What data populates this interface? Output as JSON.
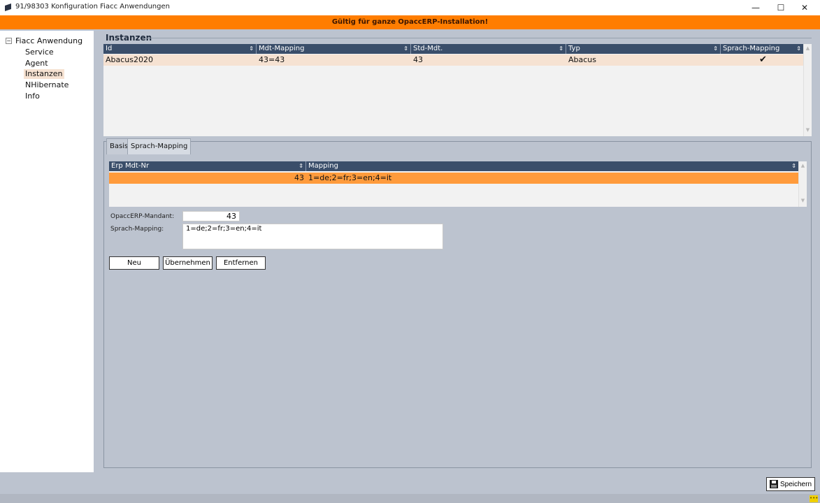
{
  "window": {
    "title": "91/98303 Konfiguration Fiacc Anwendungen",
    "min_glyph": "—",
    "max_glyph": "☐",
    "close_glyph": "✕"
  },
  "banner": {
    "text": "Gültig für ganze OpaccERP-Installation!"
  },
  "sidebar": {
    "root_label": "Fiacc Anwendung",
    "root_toggle": "−",
    "items": [
      {
        "label": "Service"
      },
      {
        "label": "Agent"
      },
      {
        "label": "Instanzen",
        "selected": true
      },
      {
        "label": "NHibernate"
      },
      {
        "label": "Info"
      }
    ]
  },
  "instanzen": {
    "group_label": "Instanzen",
    "columns": [
      "Id",
      "Mdt-Mapping",
      "Std-Mdt.",
      "Typ",
      "Sprach-Mapping"
    ],
    "sort_glyph": "⇕",
    "rows": [
      {
        "id": "Abacus2020",
        "mdt_mapping": "43=43",
        "std_mdt": "43",
        "typ": "Abacus",
        "sprach_mapping": "✔"
      }
    ],
    "row_highlight_color": "#f6e2d2"
  },
  "tabs": [
    {
      "label": "Basis"
    },
    {
      "label": "Sprach-Mapping",
      "active": true
    }
  ],
  "sprach_mapping": {
    "columns": [
      "Erp Mdt-Nr",
      "Mapping"
    ],
    "rows": [
      {
        "erp_mdt_nr": "43",
        "mapping": "1=de;2=fr;3=en;4=it"
      }
    ],
    "selected_color": "#ff9b3c"
  },
  "form": {
    "mandant_label": "OpaccERP-Mandant:",
    "mandant_value": "43",
    "sprach_label": "Sprach-Mapping:",
    "sprach_value": "1=de;2=fr;3=en;4=it"
  },
  "buttons": {
    "neu": "Neu",
    "uebernehmen": "Übernehmen",
    "entfernen": "Entfernen"
  },
  "footer": {
    "save_label": "Speichern",
    "status_glyph": "•••"
  },
  "colors": {
    "accent": "#ff7d00",
    "header": "#3a4e6a",
    "background": "#bcc3cf"
  },
  "scroll": {
    "up_glyph": "▲",
    "down_glyph": "▼"
  }
}
